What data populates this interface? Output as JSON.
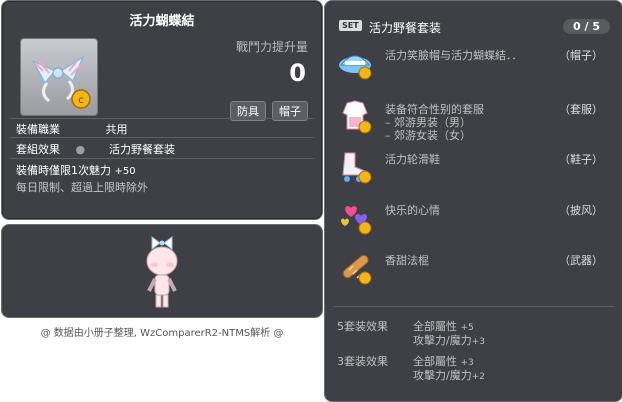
{
  "item_id": "01004948",
  "item": {
    "title": "活力蝴蝶結",
    "power_label": "戰鬥力提升量",
    "power_value": "0",
    "badges": [
      "防具",
      "帽子"
    ],
    "job_label": "裝備職業",
    "job_value": "共用",
    "set_label": "套組效果",
    "set_value": "活力野餐套装",
    "limit_text": "裝備時僅限1次魅力",
    "limit_plus": "+50",
    "limit_note": "每日限制、超過上限時除外"
  },
  "credit": "@ 数据由小册子整理, WzComparerR2-NTMS解析 @",
  "set_panel": {
    "tag": "SET",
    "title": "活力野餐套装",
    "count": "0 / 5",
    "pieces": [
      {
        "name": "活力笑臉帽与活力蝴蝶結．．",
        "type": "（帽子）",
        "icon": "hat-icon"
      },
      {
        "name": "装备符合性别的套服",
        "sub1": "– 郊游男装（男）",
        "sub2": "– 郊游女装（女）",
        "type": "（套服）",
        "icon": "outfit-icon"
      },
      {
        "name": "活力轮滑鞋",
        "type": "（鞋子）",
        "icon": "rollerskate-icon"
      },
      {
        "name": "快乐的心情",
        "type": "（披风）",
        "icon": "hearts-icon"
      },
      {
        "name": "香甜法棍",
        "type": "（武器）",
        "icon": "baguette-icon"
      }
    ],
    "bonuses": [
      {
        "label": "5套装效果",
        "lines": [
          {
            "text": "全部屬性",
            "plus": "+5"
          },
          {
            "text": "攻擊力/魔力",
            "plus": "+3"
          }
        ]
      },
      {
        "label": "3套装效果",
        "lines": [
          {
            "text": "全部屬性",
            "plus": "+3"
          },
          {
            "text": "攻擊力/魔力",
            "plus": "+2"
          }
        ]
      }
    ]
  }
}
